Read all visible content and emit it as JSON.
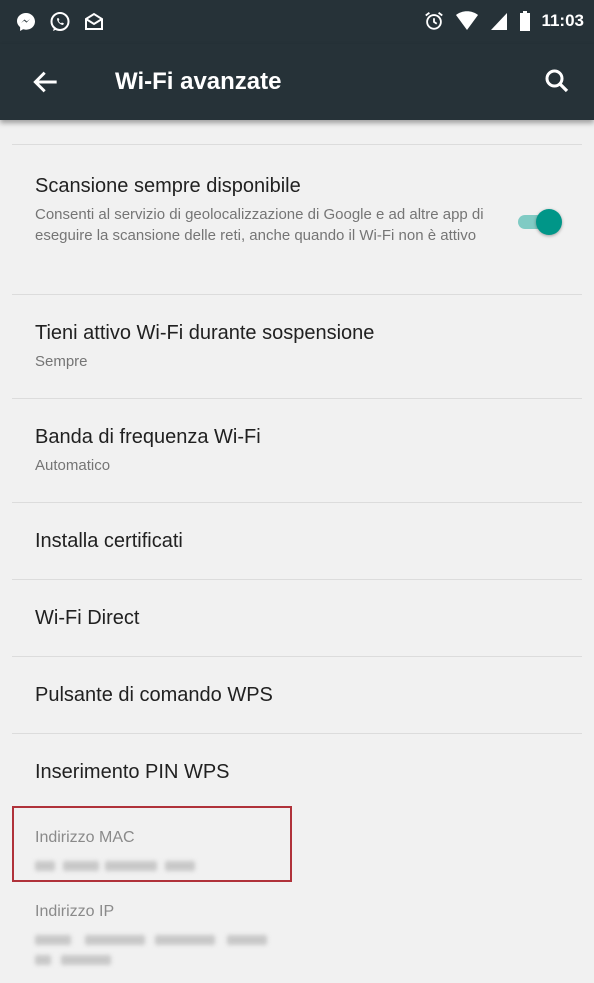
{
  "status_bar": {
    "time": "11:03",
    "left_icons": [
      "messenger-icon",
      "whatsapp-icon",
      "mail-icon"
    ],
    "right_icons": [
      "alarm-icon",
      "wifi-icon",
      "signal-icon",
      "battery-icon"
    ]
  },
  "app_bar": {
    "title": "Wi-Fi avanzate",
    "background": "#263238"
  },
  "settings": [
    {
      "title": "Scansione sempre disponibile",
      "summary": "Consenti al servizio di geolocalizzazione di Google e ad altre app di eseguire la scansione delle reti, anche quando il Wi-Fi non è attivo",
      "toggle_on": true
    },
    {
      "title": "Tieni attivo Wi-Fi durante sospensione",
      "summary": "Sempre"
    },
    {
      "title": "Banda di frequenza Wi-Fi",
      "summary": "Automatico"
    },
    {
      "title": "Installa certificati"
    },
    {
      "title": "Wi-Fi Direct"
    },
    {
      "title": "Pulsante di comando WPS"
    },
    {
      "title": "Inserimento PIN WPS"
    }
  ],
  "info": {
    "mac_label": "Indirizzo MAC",
    "ip_label": "Indirizzo IP"
  },
  "colors": {
    "accent": "#009688",
    "highlight_box": "#b0323a"
  }
}
